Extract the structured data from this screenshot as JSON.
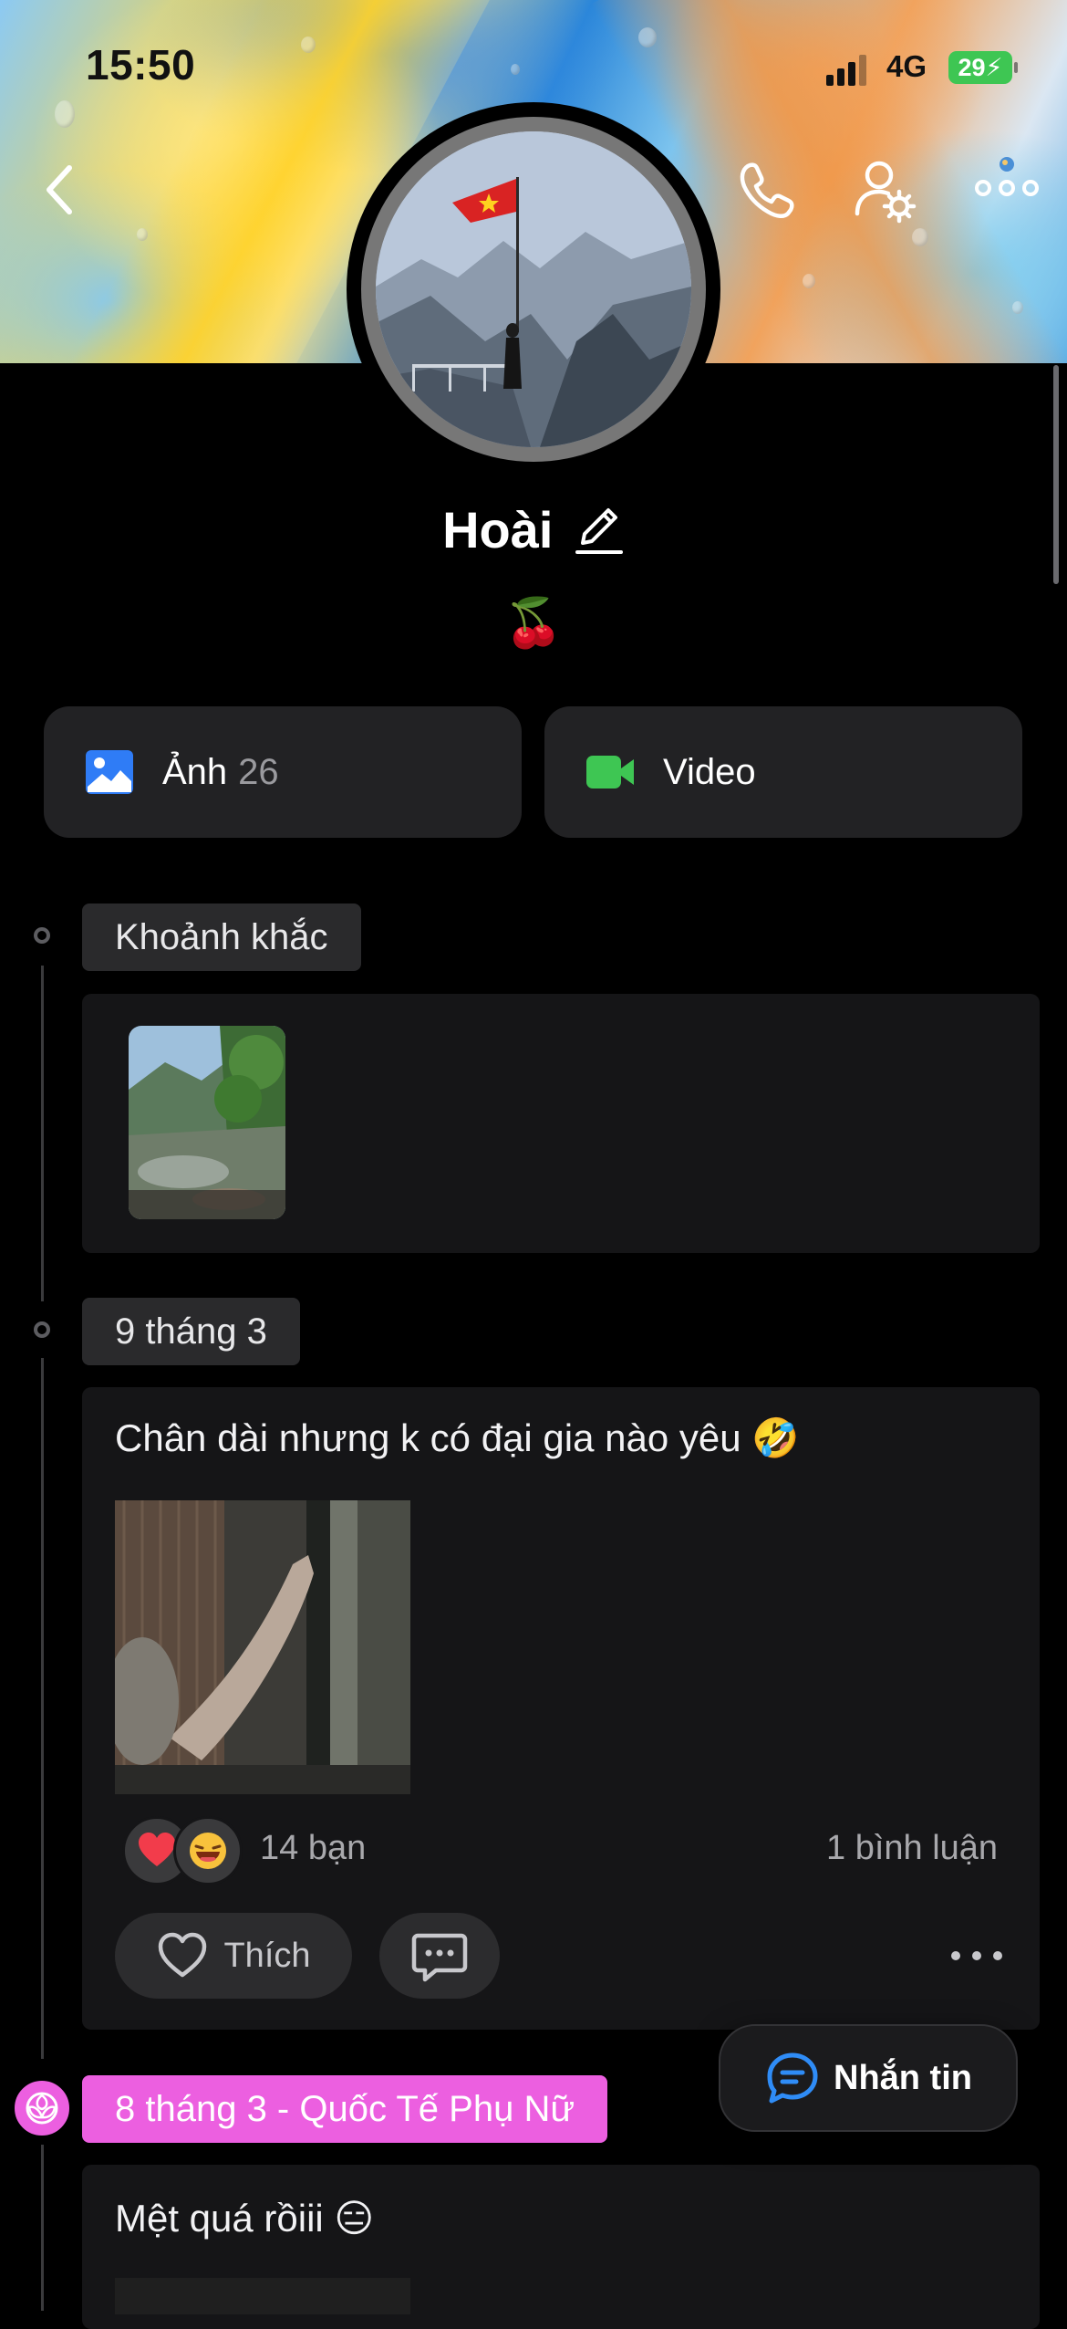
{
  "status_bar": {
    "time": "15:50",
    "network": "4G",
    "battery": "29"
  },
  "profile": {
    "name": "Hoài",
    "bio": "🍒"
  },
  "media": {
    "photos": {
      "label": "Ảnh",
      "count": "26"
    },
    "videos": {
      "label": "Video"
    }
  },
  "timeline": {
    "moments": {
      "label": "Khoảnh khắc"
    },
    "posts": [
      {
        "date": "9 tháng 3",
        "text": "Chân dài nhưng k có đại gia nào yêu 🤣",
        "likes": "14 bạn",
        "comments": "1 bình luận",
        "like_label": "Thích"
      },
      {
        "date": "8 tháng 3 - Quốc Tế Phụ Nữ",
        "text": "Mệt quá rồiii 😑"
      }
    ]
  },
  "message_button": {
    "label": "Nhắn tin"
  },
  "colors": {
    "background": "#000000",
    "card": "#151517",
    "tag": "#2a2a2c",
    "holiday_tag": "#ec5fe0",
    "photo_icon": "#2f7cf6",
    "video_icon": "#3ec653",
    "message_icon": "#2f8cf6"
  }
}
